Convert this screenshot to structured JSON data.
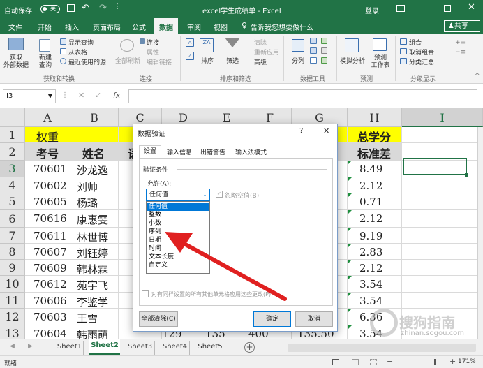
{
  "window": {
    "title": "excel学生成绩单 - Excel",
    "autosave": "自动保存",
    "autosave_state": "关",
    "login": "登录"
  },
  "tabs": [
    "文件",
    "开始",
    "插入",
    "页面布局",
    "公式",
    "数据",
    "审阅",
    "视图"
  ],
  "tell_me": "告诉我您想要做什么",
  "share": "共享",
  "ribbon": {
    "get_external": "获取\n外部数据",
    "new_query": "新建\n查询",
    "show_query": "显示查询",
    "from_table": "从表格",
    "recent_sources": "最近使用的源",
    "refresh_all": "全部刷新",
    "connections": "连接",
    "properties": "属性",
    "edit_links": "编辑链接",
    "sort": "排序",
    "filter": "筛选",
    "clear": "清除",
    "reapply": "重新应用",
    "advanced": "高级",
    "text_to_columns": "分列",
    "what_if": "模拟分析",
    "forecast_sheet": "预测\n工作表",
    "group": "组合",
    "ungroup": "取消组合",
    "subtotal": "分类汇总",
    "groups": [
      "获取和转换",
      "连接",
      "排序和筛选",
      "数据工具",
      "预测",
      "分级显示"
    ]
  },
  "formula_bar": {
    "name_box": "I3",
    "fx": "fx"
  },
  "sheet": {
    "columns": [
      "A",
      "B",
      "C",
      "D",
      "E",
      "F",
      "G",
      "H",
      "I"
    ],
    "rows": [
      "1",
      "2",
      "3",
      "4",
      "5",
      "6",
      "7",
      "8",
      "9",
      "10",
      "11",
      "12",
      "13"
    ],
    "row1": {
      "a": "权重",
      "h": "总学分"
    },
    "row2": {
      "a": "考号",
      "b": "姓名",
      "c": "语",
      "h": "标准差"
    },
    "ids": [
      "70601",
      "70602",
      "70605",
      "70616",
      "70611",
      "70607",
      "70609",
      "70612",
      "70606",
      "70603",
      "70604"
    ],
    "names": [
      "沙龙逸",
      "刘帅",
      "杨璐",
      "康惠雯",
      "林世博",
      "刘钰婷",
      "韩林霖",
      "苑宇飞",
      "李鉴学",
      "王雪",
      "韩雨萌"
    ],
    "stddev": [
      "8.49",
      "2.12",
      "0.71",
      "2.12",
      "9.19",
      "2.83",
      "2.12",
      "3.54",
      "3.54",
      "6.36",
      "3.54"
    ],
    "row13_partial": {
      "d": "129",
      "e": "135",
      "f": "400",
      "g": "135.50"
    }
  },
  "sheet_tabs": [
    "Sheet1",
    "Sheet2",
    "Sheet3",
    "Sheet4",
    "Sheet5"
  ],
  "active_sheet": "Sheet2",
  "status": {
    "ready": "就绪",
    "zoom": "171%"
  },
  "dialog": {
    "title": "数据验证",
    "help": "?",
    "close": "✕",
    "tabs": [
      "设置",
      "输入信息",
      "出错警告",
      "输入法模式"
    ],
    "criteria": "验证条件",
    "allow_label": "允许(A):",
    "allow_value": "任何值",
    "ignore_blank": "忽略空值(B)",
    "options": [
      "任何值",
      "整数",
      "小数",
      "序列",
      "日期",
      "时间",
      "文本长度",
      "自定义"
    ],
    "apply_all": "对有同样设置的所有其他单元格应用这些更改(P)",
    "clear_all": "全部清除(C)",
    "ok": "确定",
    "cancel": "取消"
  },
  "watermark": {
    "name": "搜狗指南",
    "url": "zhinan.sogou.com"
  },
  "colors": {
    "excel_green": "#217346",
    "highlight_yellow": "#ffff00",
    "arrow_red": "#e02020",
    "selection_blue": "#0078d7"
  }
}
